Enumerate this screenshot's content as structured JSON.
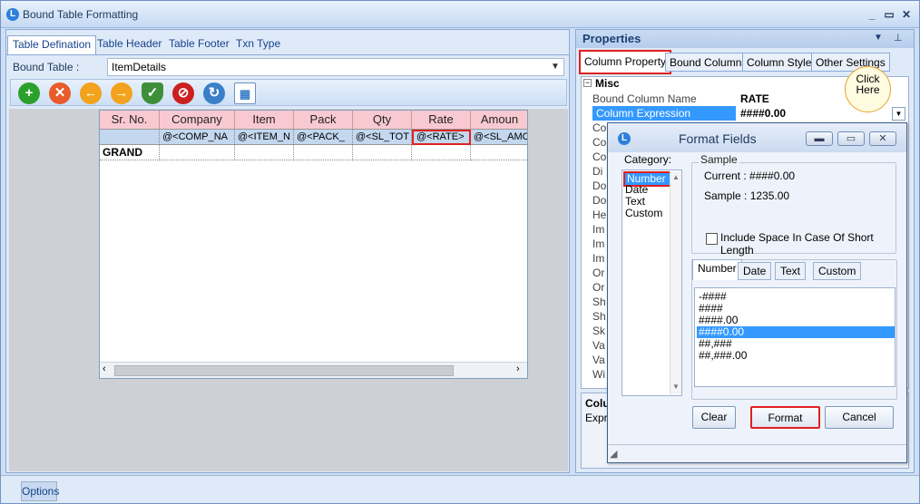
{
  "window": {
    "title": "Bound Table Formatting"
  },
  "left": {
    "tabs": [
      "Table Defination",
      "Table Header",
      "Table Footer",
      "Txn Type"
    ],
    "bound_table_label": "Bound Table :",
    "bound_table_value": "ItemDetails",
    "toolbar_icons": [
      "add-icon",
      "delete-icon",
      "back-icon",
      "forward-icon",
      "shield-icon",
      "stop-icon",
      "refresh-icon",
      "grid-icon"
    ]
  },
  "grid": {
    "headers": [
      "Sr. No.",
      "Company",
      "Item",
      "Pack",
      "Qty",
      "Rate",
      "Amoun"
    ],
    "bound_row": [
      "",
      "@<COMP_NA",
      "@<ITEM_N",
      "@<PACK_",
      "@<SL_TOT",
      "@<RATE>",
      "@<SL_AMO"
    ],
    "total_row": [
      "GRAND",
      "",
      "",
      "",
      "",
      "",
      ""
    ]
  },
  "properties": {
    "title": "Properties",
    "tabs": [
      "Column Property",
      "Bound Columns",
      "Column Style",
      "Other Settings"
    ],
    "category": "Misc",
    "rows": [
      {
        "name": "Bound Column Name",
        "value": "RATE"
      },
      {
        "name": "Column Expression",
        "value": "####0.00"
      }
    ],
    "partial_labels": [
      "Co",
      "Co",
      "Co",
      "Di",
      "Do",
      "Do",
      "He",
      "Im",
      "Im",
      "Im",
      "Or",
      "Or",
      "Sh",
      "Sh",
      "Sk",
      "Va",
      "Va",
      "Wi"
    ],
    "desc_title": "Colu",
    "desc_text": "Expre"
  },
  "dialog": {
    "title": "Format Fields",
    "category_label": "Category:",
    "categories": [
      "Number",
      "Date",
      "Text",
      "Custom"
    ],
    "sample_label": "Sample",
    "current": "Current : ####0.00",
    "sample": "Sample : 1235.00",
    "include_space": "Include Space In Case Of Short Length",
    "tabs": [
      "Number",
      "Date",
      "Text",
      "Custom"
    ],
    "formats": [
      "-####",
      "####",
      "####.00",
      "####0.00",
      "##,###",
      "##,###.00"
    ],
    "selected_format": "####0.00",
    "buttons": {
      "clear": "Clear",
      "format": "Format",
      "cancel": "Cancel"
    }
  },
  "tooltip": "Click Here",
  "status": {
    "options": "Options"
  }
}
